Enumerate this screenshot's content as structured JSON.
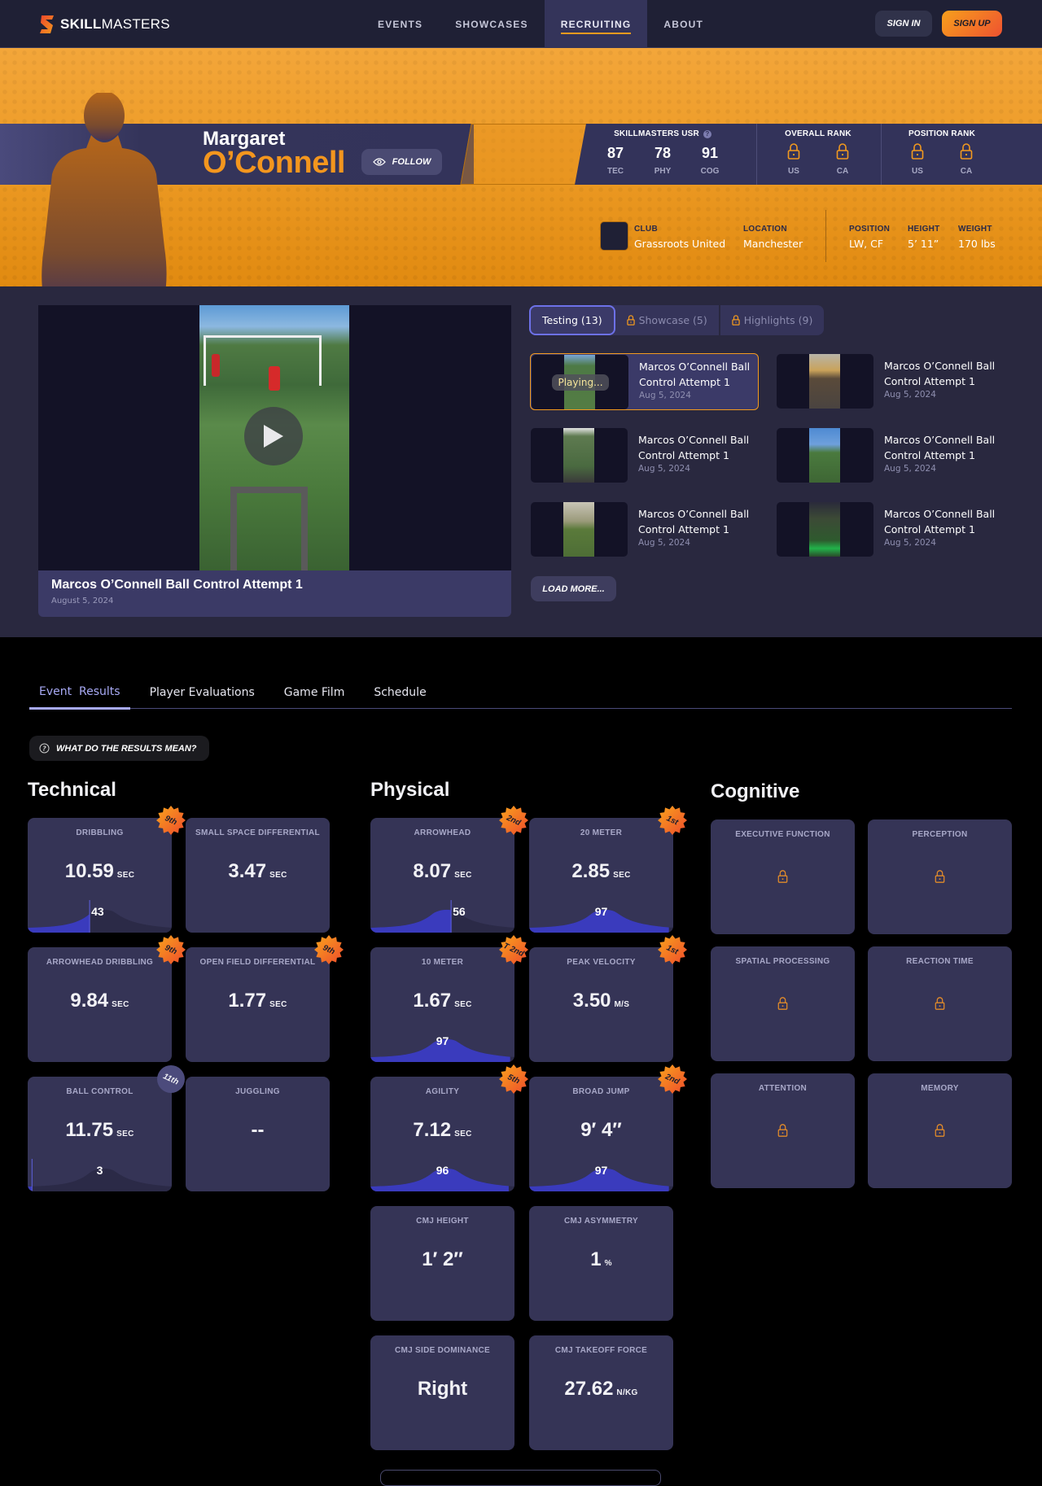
{
  "nav": {
    "logo_bold": "SKILL",
    "logo_light": "MASTERS",
    "links": [
      {
        "label": "EVENTS",
        "active": false
      },
      {
        "label": "SHOWCASES",
        "active": false
      },
      {
        "label": "RECRUITING",
        "active": true
      },
      {
        "label": "ABOUT",
        "active": false
      }
    ],
    "sign_in": "SIGN IN",
    "sign_up": "SIGN UP"
  },
  "profile": {
    "first_name": "Margaret",
    "last_name": "O’Connell",
    "follow_label": "FOLLOW",
    "usr": {
      "title": "SKILLMASTERS USR",
      "scores": [
        {
          "value": "87",
          "label": "TEC"
        },
        {
          "value": "78",
          "label": "PHY"
        },
        {
          "value": "91",
          "label": "COG"
        }
      ]
    },
    "overall_rank": {
      "title": "OVERALL RANK",
      "cols": [
        "US",
        "CA"
      ]
    },
    "position_rank": {
      "title": "POSITION RANK",
      "cols": [
        "US",
        "CA"
      ]
    },
    "info": {
      "club_label": "CLUB",
      "club": "Grassroots United",
      "location_label": "LOCATION",
      "location": "Manchester",
      "position_label": "POSITION",
      "position": "LW, CF",
      "height_label": "HEIGHT",
      "height": "5’ 11”",
      "weight_label": "WEIGHT",
      "weight": "170 lbs"
    }
  },
  "media": {
    "player": {
      "title": "Marcos O’Connell Ball Control Attempt 1",
      "date": "August 5, 2024"
    },
    "tabs": [
      {
        "label": "Testing (13)",
        "active": true,
        "locked": false
      },
      {
        "label": "Showcase (5)",
        "active": false,
        "locked": true
      },
      {
        "label": "Highlights (9)",
        "active": false,
        "locked": true
      }
    ],
    "playing_label": "Playing...",
    "videos": [
      {
        "title": "Marcos O’Connell Ball Control Attempt 1",
        "date": "Aug 5, 2024",
        "playing": true
      },
      {
        "title": "Marcos O’Connell Ball Control Attempt 1",
        "date": "Aug 5, 2024",
        "playing": false
      },
      {
        "title": "Marcos O’Connell Ball Control Attempt 1",
        "date": "Aug 5, 2024",
        "playing": false
      },
      {
        "title": "Marcos O’Connell Ball Control Attempt 1",
        "date": "Aug 5, 2024",
        "playing": false
      },
      {
        "title": "Marcos O’Connell Ball Control Attempt 1",
        "date": "Aug 5, 2024",
        "playing": false
      },
      {
        "title": "Marcos O’Connell Ball Control Attempt 1",
        "date": "Aug 5, 2024",
        "playing": false
      }
    ],
    "load_more": "LOAD MORE..."
  },
  "results": {
    "tabs": [
      {
        "label": "Event  Results",
        "active": true
      },
      {
        "label": "Player Evaluations",
        "active": false
      },
      {
        "label": "Game Film",
        "active": false
      },
      {
        "label": "Schedule",
        "active": false
      }
    ],
    "help_label": "WHAT DO THE RESULTS MEAN?",
    "technical": {
      "title": "Technical",
      "cards": [
        {
          "title": "DRIBBLING",
          "value": "10.59",
          "unit": "SEC",
          "percentile": 43,
          "badge": "9th",
          "badge_style": "orange"
        },
        {
          "title": "SMALL SPACE DIFFERENTIAL",
          "value": "3.47",
          "unit": "SEC",
          "percentile": null,
          "badge": null
        },
        {
          "title": "ARROWHEAD DRIBBLING",
          "value": "9.84",
          "unit": "SEC",
          "percentile": null,
          "badge": "9th",
          "badge_style": "orange"
        },
        {
          "title": "OPEN FIELD DIFFERENTIAL",
          "value": "1.77",
          "unit": "SEC",
          "percentile": null,
          "badge": "9th",
          "badge_style": "orange"
        },
        {
          "title": "BALL CONTROL",
          "value": "11.75",
          "unit": "SEC",
          "percentile": 3,
          "badge": "11th",
          "badge_style": "grey"
        },
        {
          "title": "JUGGLING",
          "value": "--",
          "unit": "",
          "percentile": null,
          "badge": null
        }
      ]
    },
    "physical": {
      "title": "Physical",
      "cards": [
        {
          "title": "ARROWHEAD",
          "value": "8.07",
          "unit": "SEC",
          "percentile": 56,
          "badge": "2nd",
          "badge_style": "orange"
        },
        {
          "title": "20 METER",
          "value": "2.85",
          "unit": "SEC",
          "percentile": 97,
          "badge": "1st",
          "badge_style": "orange"
        },
        {
          "title": "10 METER",
          "value": "1.67",
          "unit": "SEC",
          "percentile": 97,
          "badge": "T 2nd",
          "badge_style": "orange"
        },
        {
          "title": "PEAK VELOCITY",
          "value": "3.50",
          "unit": "M/S",
          "percentile": null,
          "badge": "1st",
          "badge_style": "orange"
        },
        {
          "title": "AGILITY",
          "value": "7.12",
          "unit": "SEC",
          "percentile": 96,
          "badge": "5th",
          "badge_style": "orange"
        },
        {
          "title": "BROAD JUMP",
          "value": "9′ 4″",
          "unit": "",
          "percentile": 97,
          "badge": "2nd",
          "badge_style": "orange"
        },
        {
          "title": "CMJ HEIGHT",
          "value": "1′ 2″",
          "unit": "",
          "percentile": null,
          "badge": null
        },
        {
          "title": "CMJ ASYMMETRY",
          "value": "1",
          "unit": "%",
          "percentile": null,
          "badge": null
        },
        {
          "title": "CMJ SIDE DOMINANCE",
          "value": "Right",
          "unit": "",
          "percentile": null,
          "badge": null
        },
        {
          "title": "CMJ TAKEOFF FORCE",
          "value": "27.62",
          "unit": "N/KG",
          "percentile": null,
          "badge": null
        }
      ]
    },
    "cognitive": {
      "title": "Cognitive",
      "cards": [
        {
          "title": "EXECUTIVE FUNCTION",
          "locked": true
        },
        {
          "title": "PERCEPTION",
          "locked": true
        },
        {
          "title": "SPATIAL PROCESSING",
          "locked": true
        },
        {
          "title": "REACTION TIME",
          "locked": true
        },
        {
          "title": "ATTENTION",
          "locked": true
        },
        {
          "title": "MEMORY",
          "locked": true
        }
      ]
    }
  },
  "colors": {
    "accent_orange": "#f39a1e",
    "nav_bg": "#1f2035",
    "card_bg": "#353456",
    "curve_fill": "#3a3bbd",
    "tab_active": "#a8aaf5"
  }
}
